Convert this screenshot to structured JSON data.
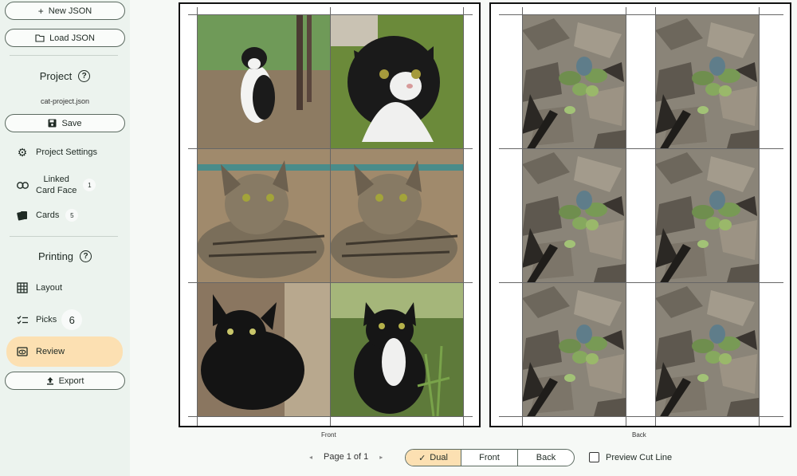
{
  "sidebar": {
    "new_json": "New JSON",
    "load_json": "Load JSON",
    "project_title": "Project",
    "filename": "cat-project.json",
    "save": "Save",
    "project_settings": "Project Settings",
    "linked_card_face_line1": "Linked",
    "linked_card_face_line2": "Card Face",
    "linked_count": "1",
    "cards": "Cards",
    "cards_count": "5",
    "printing_title": "Printing",
    "layout": "Layout",
    "picks": "Picks",
    "picks_count": "6",
    "review": "Review",
    "export": "Export",
    "help_glyph": "?"
  },
  "pages": {
    "front_label": "Front",
    "back_label": "Back",
    "front_cards": [
      {
        "name": "black-white-cat-sitting"
      },
      {
        "name": "black-white-cat-closeup"
      },
      {
        "name": "tabby-cat-lying"
      },
      {
        "name": "tabby-cat-lying-2"
      },
      {
        "name": "black-cat"
      },
      {
        "name": "black-white-cat-plants"
      }
    ],
    "back_card": "plant-leaves-back"
  },
  "footer": {
    "pager_text": "Page 1 of 1",
    "prev_arrow": "◂",
    "next_arrow": "▸",
    "view_options": [
      "Dual",
      "Front",
      "Back"
    ],
    "selected_view": "Dual",
    "check_glyph": "✓",
    "preview_cut_line": "Preview Cut Line"
  },
  "colors": {
    "accent": "#fce0b2",
    "sidebar_bg": "#ecf3ee"
  }
}
